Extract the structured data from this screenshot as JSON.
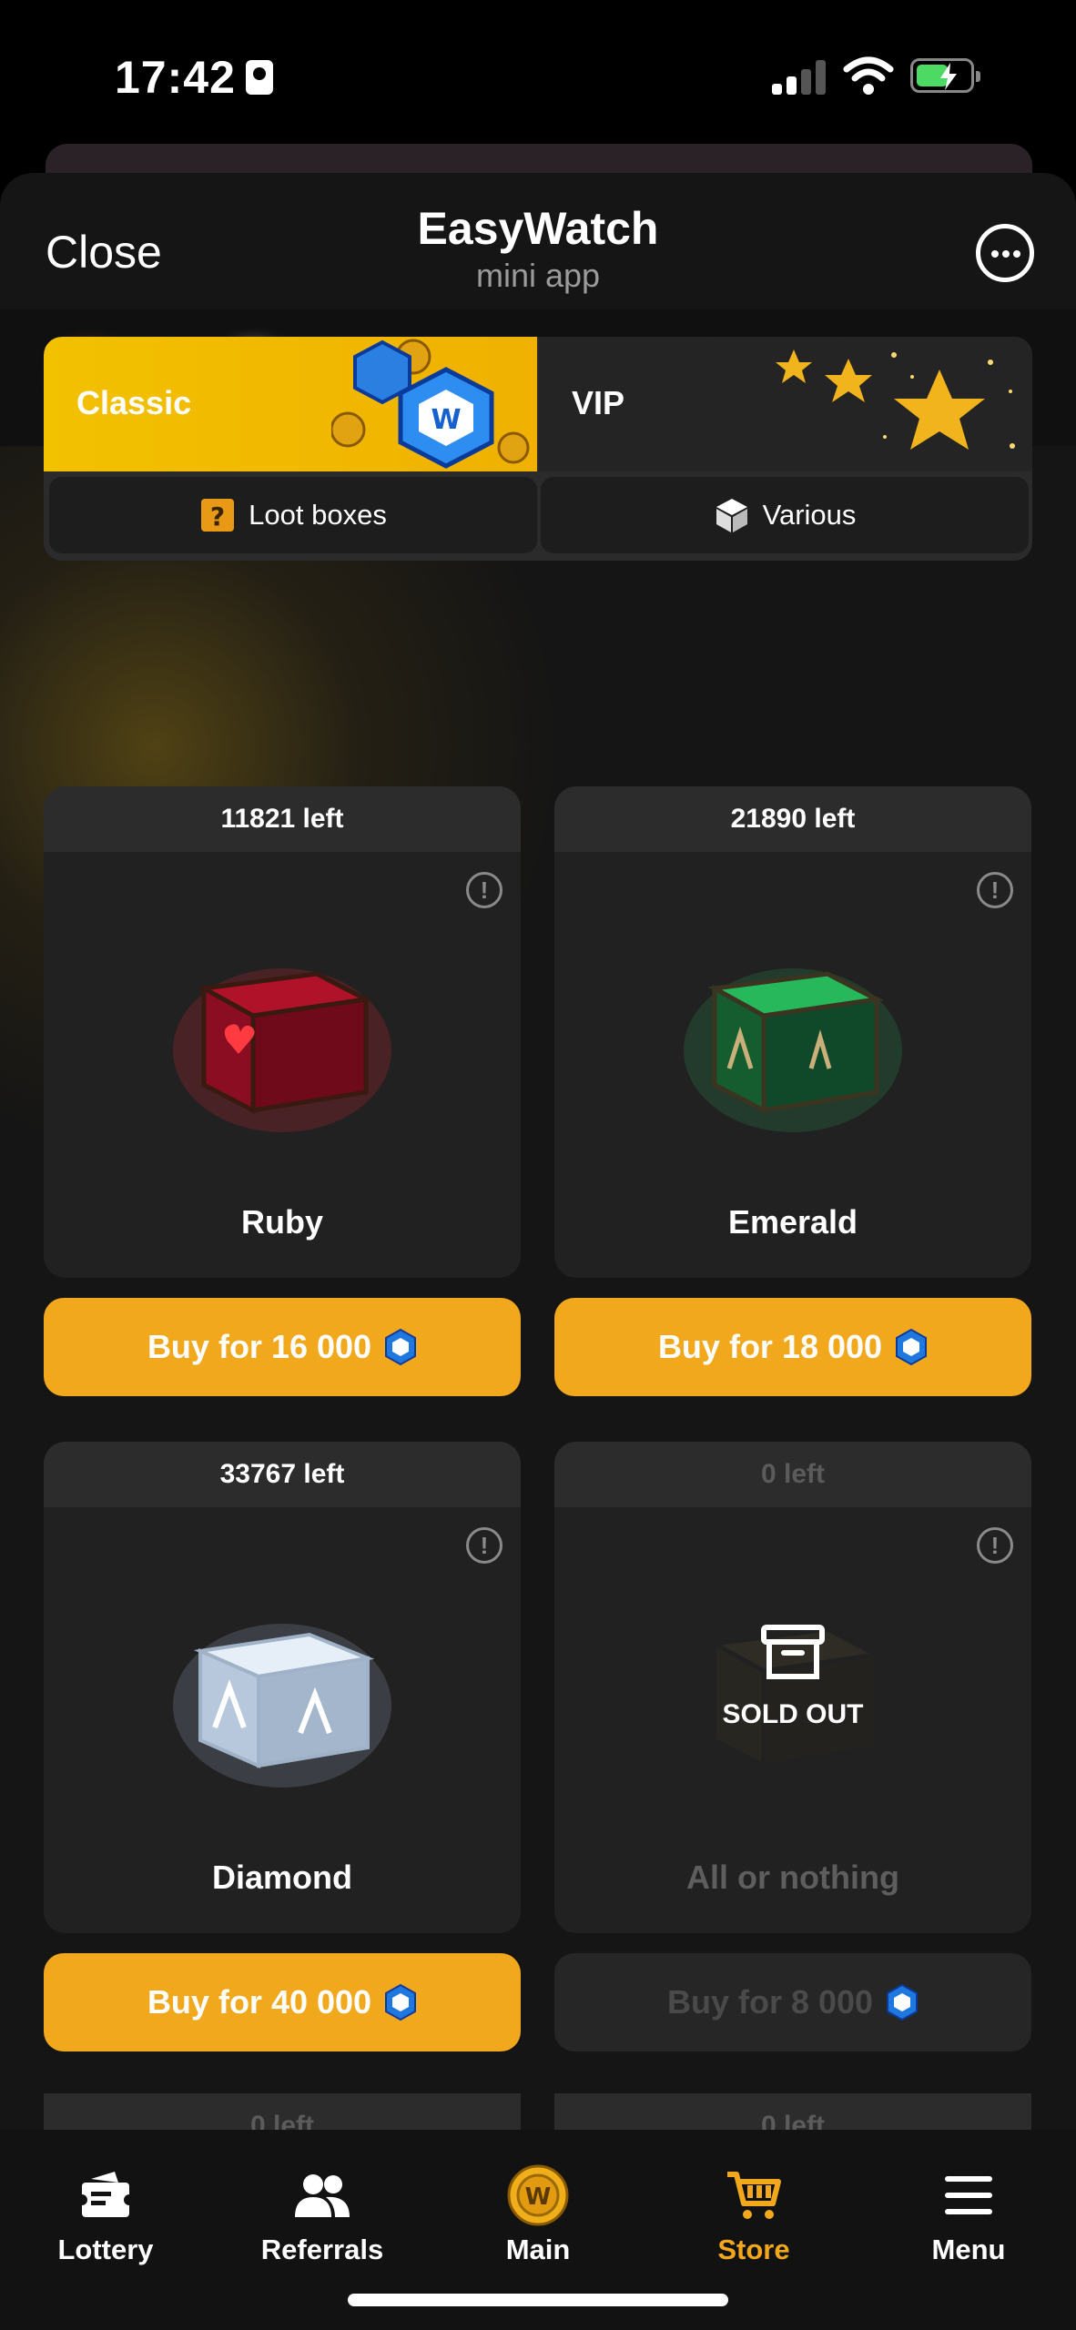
{
  "status_bar": {
    "time": "17:42"
  },
  "header": {
    "close_label": "Close",
    "title": "EasyWatch",
    "subtitle": "mini app"
  },
  "category_tabs": [
    {
      "label": "Classic",
      "selected": true
    },
    {
      "label": "VIP",
      "selected": false
    }
  ],
  "sub_tabs": [
    {
      "label": "Loot boxes",
      "icon": "question-box-icon"
    },
    {
      "label": "Various",
      "icon": "cube-icon"
    }
  ],
  "cards": [
    {
      "left": "11821 left",
      "name": "Ruby",
      "buy": "Buy for 16 000",
      "sold_out": false
    },
    {
      "left": "21890 left",
      "name": "Emerald",
      "buy": "Buy for 18 000",
      "sold_out": false
    },
    {
      "left": "33767 left",
      "name": "Diamond",
      "buy": "Buy for 40 000",
      "sold_out": false
    },
    {
      "left": "0 left",
      "name": "All or nothing",
      "buy": "Buy for 8 000",
      "sold_out": true,
      "sold_label": "SOLD OUT"
    }
  ],
  "peek_cards": [
    {
      "left": "0 left"
    },
    {
      "left": "0 left"
    }
  ],
  "nav": [
    {
      "label": "Lottery",
      "icon": "ticket-icon"
    },
    {
      "label": "Referrals",
      "icon": "people-icon"
    },
    {
      "label": "Main",
      "icon": "coin-icon"
    },
    {
      "label": "Store",
      "icon": "cart-icon",
      "active": true
    },
    {
      "label": "Menu",
      "icon": "hamburger-icon"
    }
  ],
  "colors": {
    "accent": "#f2a81d",
    "classic_tab": "#f2c100",
    "background": "#151515",
    "card": "#212121"
  }
}
